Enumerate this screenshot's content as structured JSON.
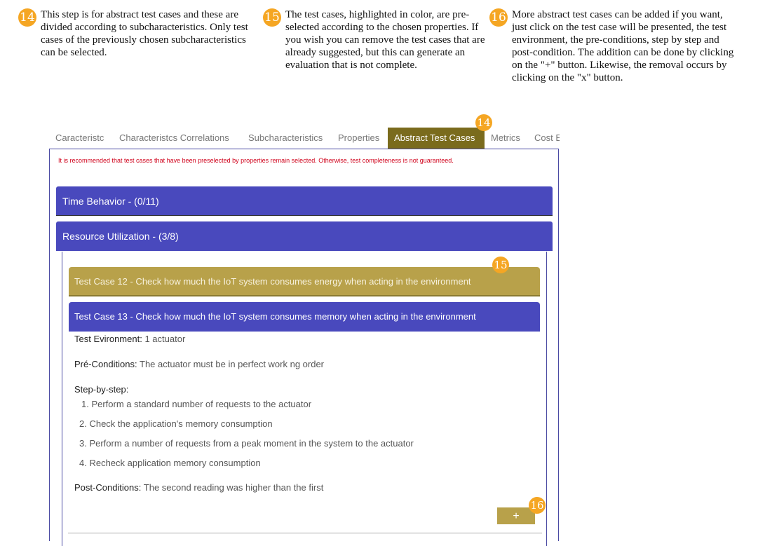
{
  "notes": [
    {
      "number": "14",
      "text": "This step is for abstract test cases and these are divided according to subcharacteristics. Only test cases of the previously chosen subcharacteristics can be selected."
    },
    {
      "number": "15",
      "text": "The test cases, highlighted in color, are pre-selected according to the chosen properties. If you wish you can remove the test cases that are already suggested, but this can generate an evaluation that is not complete."
    },
    {
      "number": "16",
      "text": "More abstract test cases can be added if you want, just click on the test case will be presented, the test environment, the pre-conditions, step by step and post-condition. The addition can be done by clicking on the \"+\" button. Likewise, the removal occurs by clicking on the \"x\" button."
    }
  ],
  "tabs": [
    "Caracteristc",
    "Characteristcs Correlations",
    "Subcharacteristics",
    "Properties",
    "Abstract Test Cases",
    "Metrics",
    "Cost E"
  ],
  "active_tab": "Abstract Test Cases",
  "badges": {
    "tabs": "14",
    "test_case": "15",
    "add": "16"
  },
  "warning": "It is recommended that test cases that have been preselected by properties remain selected. Otherwise, test completeness is not guaranteed.",
  "accordions": [
    {
      "label": "Time Behavior - (0/11)"
    },
    {
      "label": "Resource Utilization - (3/8)"
    }
  ],
  "test_cases": [
    {
      "label": "Test Case 12 - Check how much the IoT system consumes energy when acting in the environment",
      "preselected": true
    },
    {
      "label": "Test Case 13 - Check how much the IoT system consumes memory when acting in the environment",
      "preselected": false
    }
  ],
  "detail": {
    "environment_label": "Test Evironment:",
    "environment_value": "1 actuator",
    "pre_label": "Pré-Conditions:",
    "pre_value": "The actuator must be in perfect work ng order",
    "steps_label": "Step-by-step:",
    "steps": [
      "1. Perform a standard number of requests to the actuator",
      "2. Check the application's memory consumption",
      "3. Perform a number of requests from a peak moment in the system to the actuator",
      "4. Recheck application memory consumption"
    ],
    "post_label": "Post-Conditions:",
    "post_value": "The second reading was higher than the first"
  },
  "add_button": "+",
  "colors": {
    "accent_blue": "#4949bd",
    "accent_gold": "#b8a14a",
    "tab_active": "#7a6b1d",
    "badge": "#f5a623",
    "warning": "#d0021b"
  }
}
